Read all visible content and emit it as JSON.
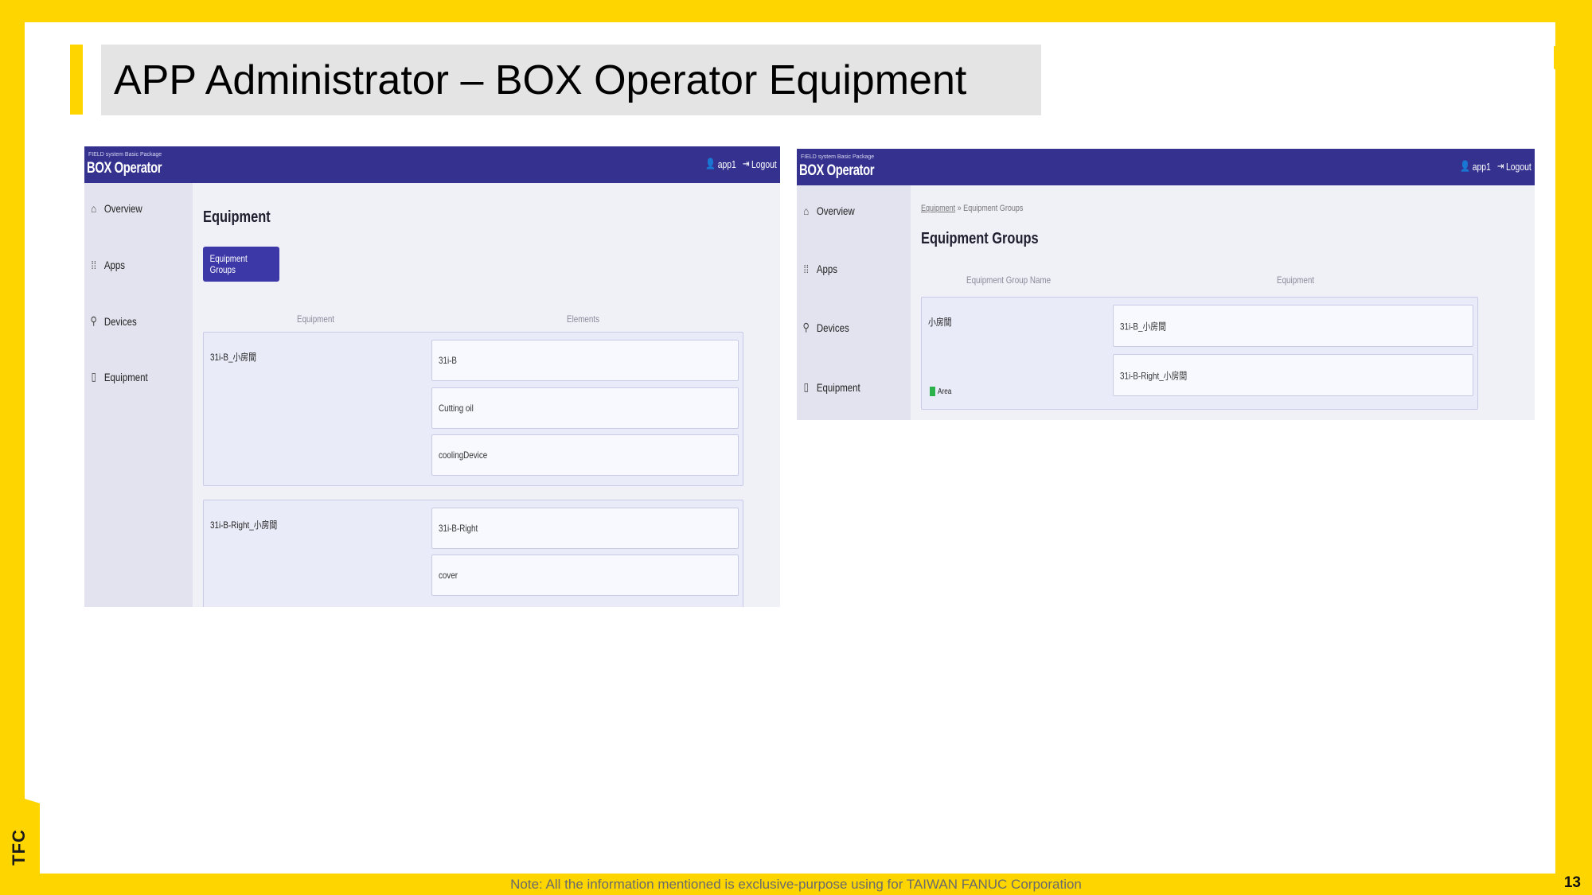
{
  "slide": {
    "title": "APP Administrator – BOX Operator Equipment",
    "footer_note": "Note: All the information mentioned is exclusive-purpose using for TAIWAN FANUC Corporation",
    "page_number": "13",
    "side_logo": "TFC"
  },
  "left_app": {
    "header": {
      "brand_small": "FIELD system Basic Package",
      "brand": "BOX Operator",
      "user": "app1",
      "logout": "Logout"
    },
    "sidebar": [
      "Overview",
      "Apps",
      "Devices",
      "Equipment"
    ],
    "page_title": "Equipment",
    "button": "Equipment Groups",
    "col_equipment": "Equipment",
    "col_elements": "Elements",
    "groups": [
      {
        "name": "31i-B_小房間",
        "elements": [
          "31i-B",
          "Cutting oil",
          "coolingDevice"
        ]
      },
      {
        "name": "31i-B-Right_小房間",
        "elements": [
          "31i-B-Right",
          "cover"
        ]
      }
    ]
  },
  "right_app": {
    "header": {
      "brand_small": "FIELD system Basic Package",
      "brand": "BOX Operator",
      "user": "app1",
      "logout": "Logout"
    },
    "sidebar": [
      "Overview",
      "Apps",
      "Devices",
      "Equipment"
    ],
    "breadcrumb": {
      "link": "Equipment",
      "separator": "»",
      "current": "Equipment Groups"
    },
    "page_title": "Equipment Groups",
    "col_group_name": "Equipment Group Name",
    "col_equipment": "Equipment",
    "group": {
      "name": "小房間",
      "badge": "Area",
      "badge_color": "#2bb24c",
      "equipment": [
        "31i-B_小房間",
        "31i-B-Right_小房間"
      ]
    }
  }
}
